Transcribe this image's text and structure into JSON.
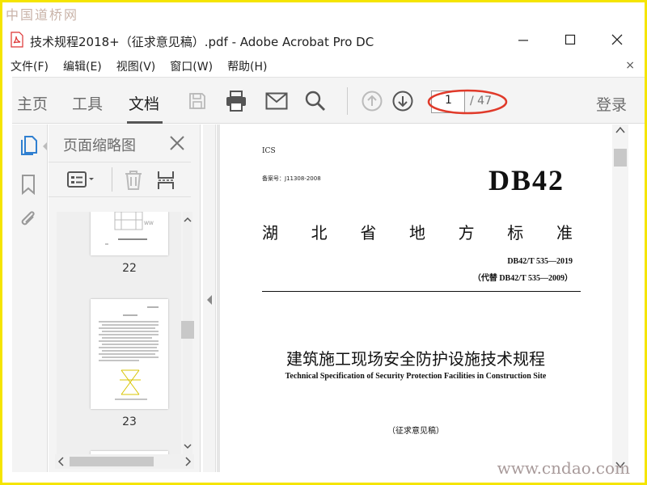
{
  "watermark": {
    "top": "中国道桥网",
    "bottom": "www.cndao.com"
  },
  "window": {
    "title": "技术规程2018+（征求意见稿）.pdf - Adobe Acrobat Pro DC"
  },
  "menu": {
    "items": [
      "文件(F)",
      "编辑(E)",
      "视图(V)",
      "窗口(W)",
      "帮助(H)"
    ],
    "close": "×"
  },
  "toolbar": {
    "tabs": [
      "主页",
      "工具",
      "文档"
    ],
    "active_tab": "文档",
    "page_current": "1",
    "page_total": "/ 47",
    "signin": "登录",
    "icons": [
      "save-icon",
      "print-icon",
      "email-icon",
      "search-icon",
      "page-up-icon",
      "page-down-icon"
    ],
    "highlight_color": "#e03a2a"
  },
  "thumbnails": {
    "title": "页面缩略图",
    "pages": [
      {
        "label": "22"
      },
      {
        "label": "23"
      }
    ]
  },
  "document": {
    "ics": "ICS",
    "record": "备案号：J11308-2008",
    "code": "DB42",
    "std_title": [
      "湖",
      "北",
      "省",
      "地",
      "方",
      "标",
      "准"
    ],
    "std_no": "DB42/T  535—2019",
    "std_replace": "（代替 DB42/T 535—2009）",
    "title": "建筑施工现场安全防护设施技术规程",
    "subtitle": "Technical Specification of Security Protection Facilities in Construction Site",
    "draft": "（征求意见稿）"
  },
  "colors": {
    "frame_border": "#f5e500",
    "accent": "#2f7fd0"
  }
}
